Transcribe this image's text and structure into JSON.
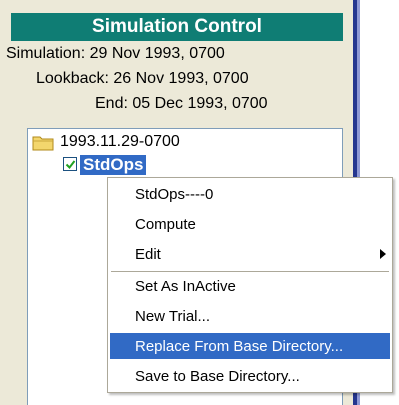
{
  "panel": {
    "title": "Simulation Control",
    "simulation": "Simulation: 29 Nov 1993, 0700",
    "lookback": "Lookback: 26 Nov 1993, 0700",
    "end": "End: 05 Dec 1993, 0700"
  },
  "tree": {
    "root_label": "1993.11.29-0700",
    "node_label": "StdOps",
    "node_checked": true
  },
  "context_menu": {
    "items": [
      {
        "label": "StdOps----0"
      },
      {
        "label": "Compute"
      },
      {
        "label": "Edit",
        "submenu": true
      },
      {
        "label": "Set As InActive"
      },
      {
        "label": "New Trial..."
      },
      {
        "label": "Replace From Base Directory...",
        "highlighted": true
      },
      {
        "label": "Save to Base Directory..."
      }
    ]
  },
  "colors": {
    "title_bg": "#0f7d74",
    "selection": "#316ac5",
    "panel_bg": "#ece9d8"
  }
}
